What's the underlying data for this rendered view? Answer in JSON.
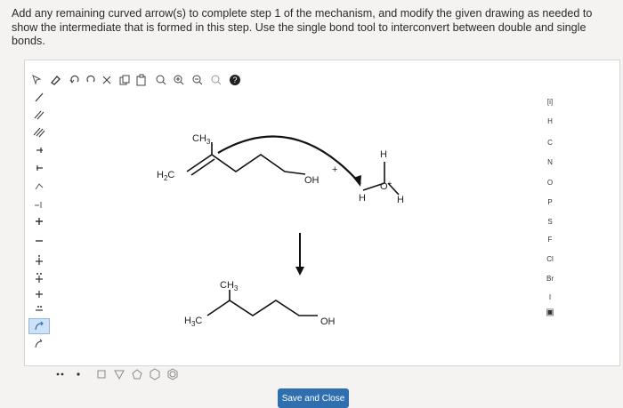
{
  "prompt": {
    "text": "Add any remaining curved arrow(s) to complete step 1 of the mechanism, and modify the given drawing as needed to show the intermediate that is formed in this step. Use the single bond tool to interconvert between double and single bonds."
  },
  "molecule_top": {
    "ch3": "CH",
    "ch3_sub": "3",
    "h2c": "H",
    "h2c_sub": "2",
    "h2c_c": "C",
    "oh": "OH",
    "plus": "+",
    "h_top": "H",
    "h_left": "H",
    "h_right": "H",
    "o_plus": "O",
    "o_charge": "+"
  },
  "molecule_bottom": {
    "ch3": "CH",
    "ch3_sub": "3",
    "h3c": "H",
    "h3c_sub": "3",
    "h3c_c": "C",
    "oh": "OH"
  },
  "periodic": {
    "header": "[i]",
    "elements": [
      "H",
      "C",
      "N",
      "O",
      "P",
      "S",
      "F",
      "Cl",
      "Br",
      "I"
    ]
  },
  "buttons": {
    "save_close": "Save and Close"
  },
  "icons": {
    "top": [
      "pointer-icon",
      "eraser-icon",
      "undo-icon",
      "redo-icon",
      "cut-icon",
      "copy-icon",
      "paste-icon",
      "zoom-fit-icon",
      "zoom-in-icon",
      "zoom-out-icon",
      "zoom-reset-icon",
      "help-icon"
    ],
    "left": [
      "single-bond-icon",
      "double-bond-icon",
      "triple-bond-icon",
      "wedge-bond-icon",
      "hash-bond-icon",
      "chain-icon",
      "stereo-icon",
      "positive-charge-icon",
      "negative-charge-icon",
      "radical-plus-icon",
      "lone-pair-plus-icon",
      "electron-pair-icon",
      "charge-plus-icon",
      "curved-arrow-icon",
      "fishhook-arrow-icon",
      "full-arrow-icon"
    ],
    "bottom": [
      "two-dots-icon",
      "one-dot-icon",
      "cyclopropane-icon",
      "cyclobutane-icon",
      "cyclopentane-icon",
      "cyclohexane-icon",
      "benzene-icon"
    ]
  },
  "colors": {
    "accent": "#2f6fb0",
    "toolbar_highlight": "#cfe2f5"
  }
}
